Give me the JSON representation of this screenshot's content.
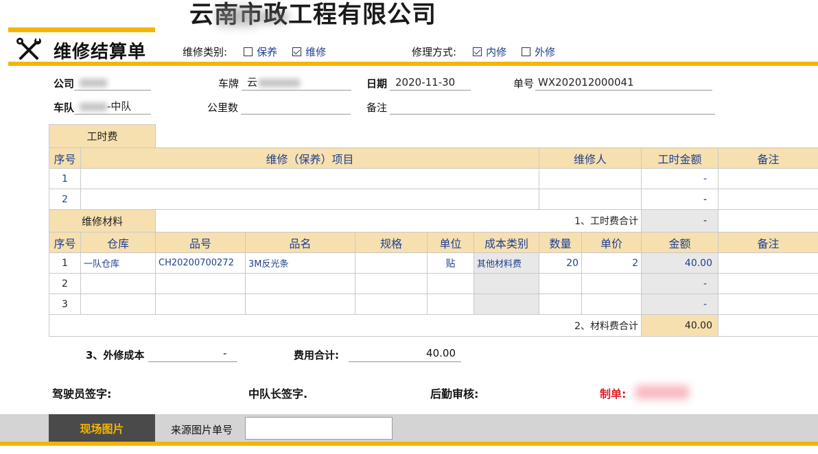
{
  "company_name": "云南市政工程有限公司",
  "form_title": "维修结算单",
  "repair_category": {
    "label": "维修类别:",
    "options": [
      {
        "label": "保养",
        "checked": false
      },
      {
        "label": "维修",
        "checked": true
      }
    ]
  },
  "repair_method": {
    "label": "修理方式:",
    "options": [
      {
        "label": "内修",
        "checked": true
      },
      {
        "label": "外修",
        "checked": false
      }
    ]
  },
  "fields": {
    "company_label": "公司",
    "plate_label": "车牌",
    "plate_value": "云",
    "date_label": "日期",
    "date_value": "2020-11-30",
    "order_label": "单号",
    "order_value": "WX202012000041",
    "team_label": "车队",
    "team_value": "-中队",
    "mileage_label": "公里数",
    "remark_label": "备注"
  },
  "labor": {
    "tab_label": "工时费",
    "headers": [
      "序号",
      "维修（保养）项目",
      "维修人",
      "工时金额",
      "备注"
    ],
    "rows": [
      {
        "no": "1",
        "item": "",
        "worker": "",
        "amount": "-",
        "remark": ""
      },
      {
        "no": "2",
        "item": "",
        "worker": "",
        "amount": "-",
        "remark": ""
      }
    ],
    "total_label": "1、工时费合计",
    "total_value": "-"
  },
  "materials": {
    "tab_label": "维修材料",
    "headers": [
      "序号",
      "仓库",
      "品号",
      "品名",
      "规格",
      "单位",
      "成本类别",
      "数量",
      "单价",
      "金额",
      "备注"
    ],
    "rows": [
      {
        "no": "1",
        "warehouse": "一队仓库",
        "code": "CH20200700272",
        "name": "3M反光条",
        "spec": "",
        "unit": "贴",
        "cost_type": "其他材料费",
        "qty": "20",
        "price": "2",
        "amount": "40.00",
        "remark": ""
      },
      {
        "no": "2",
        "warehouse": "",
        "code": "",
        "name": "",
        "spec": "",
        "unit": "",
        "cost_type": "",
        "qty": "",
        "price": "",
        "amount": "-",
        "remark": ""
      },
      {
        "no": "3",
        "warehouse": "",
        "code": "",
        "name": "",
        "spec": "",
        "unit": "",
        "cost_type": "",
        "qty": "",
        "price": "",
        "amount": "-",
        "remark": ""
      }
    ],
    "total_label": "2、材料费合计",
    "total_value": "40.00"
  },
  "summary": {
    "external_label": "3、外修成本",
    "external_value": "-",
    "total_label": "费用合计:",
    "total_value": "40.00"
  },
  "signatures": {
    "driver": "驾驶员签字:",
    "captain": "中队长签字.",
    "logistics": "后勤审核:",
    "maker": "制单:"
  },
  "bottom": {
    "photo_button": "现场图片",
    "source_label": "来源图片单号",
    "source_value": ""
  },
  "colors": {
    "accent": "#f5b400",
    "header_bg": "#f6e0b0",
    "value_text": "#1f3f8f",
    "maker_red": "#e0202a"
  }
}
